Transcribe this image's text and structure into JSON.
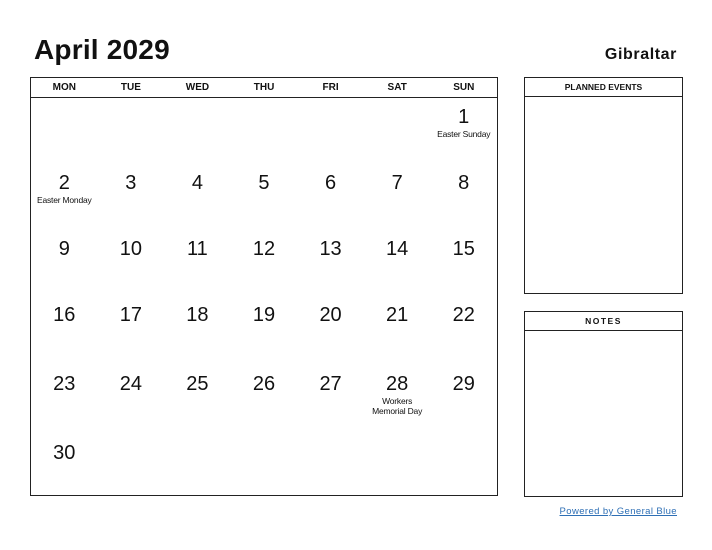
{
  "header": {
    "title": "April 2029",
    "country": "Gibraltar"
  },
  "weekdays": [
    "MON",
    "TUE",
    "WED",
    "THU",
    "FRI",
    "SAT",
    "SUN"
  ],
  "weeks": [
    [
      {
        "day": "",
        "event": ""
      },
      {
        "day": "",
        "event": ""
      },
      {
        "day": "",
        "event": ""
      },
      {
        "day": "",
        "event": ""
      },
      {
        "day": "",
        "event": ""
      },
      {
        "day": "",
        "event": ""
      },
      {
        "day": "1",
        "event": "Easter Sunday"
      }
    ],
    [
      {
        "day": "2",
        "event": "Easter Monday"
      },
      {
        "day": "3",
        "event": ""
      },
      {
        "day": "4",
        "event": ""
      },
      {
        "day": "5",
        "event": ""
      },
      {
        "day": "6",
        "event": ""
      },
      {
        "day": "7",
        "event": ""
      },
      {
        "day": "8",
        "event": ""
      }
    ],
    [
      {
        "day": "9",
        "event": ""
      },
      {
        "day": "10",
        "event": ""
      },
      {
        "day": "11",
        "event": ""
      },
      {
        "day": "12",
        "event": ""
      },
      {
        "day": "13",
        "event": ""
      },
      {
        "day": "14",
        "event": ""
      },
      {
        "day": "15",
        "event": ""
      }
    ],
    [
      {
        "day": "16",
        "event": ""
      },
      {
        "day": "17",
        "event": ""
      },
      {
        "day": "18",
        "event": ""
      },
      {
        "day": "19",
        "event": ""
      },
      {
        "day": "20",
        "event": ""
      },
      {
        "day": "21",
        "event": ""
      },
      {
        "day": "22",
        "event": ""
      }
    ],
    [
      {
        "day": "23",
        "event": ""
      },
      {
        "day": "24",
        "event": ""
      },
      {
        "day": "25",
        "event": ""
      },
      {
        "day": "26",
        "event": ""
      },
      {
        "day": "27",
        "event": ""
      },
      {
        "day": "28",
        "event": "Workers Memorial Day"
      },
      {
        "day": "29",
        "event": ""
      }
    ],
    [
      {
        "day": "30",
        "event": ""
      },
      {
        "day": "",
        "event": ""
      },
      {
        "day": "",
        "event": ""
      },
      {
        "day": "",
        "event": ""
      },
      {
        "day": "",
        "event": ""
      },
      {
        "day": "",
        "event": ""
      },
      {
        "day": "",
        "event": ""
      }
    ]
  ],
  "panels": {
    "planned_events": "PLANNED EVENTS",
    "notes": "NOTES"
  },
  "footer": {
    "link": "Powered by General Blue"
  },
  "colors": {
    "link": "#2e6fb5",
    "border": "#222222"
  }
}
